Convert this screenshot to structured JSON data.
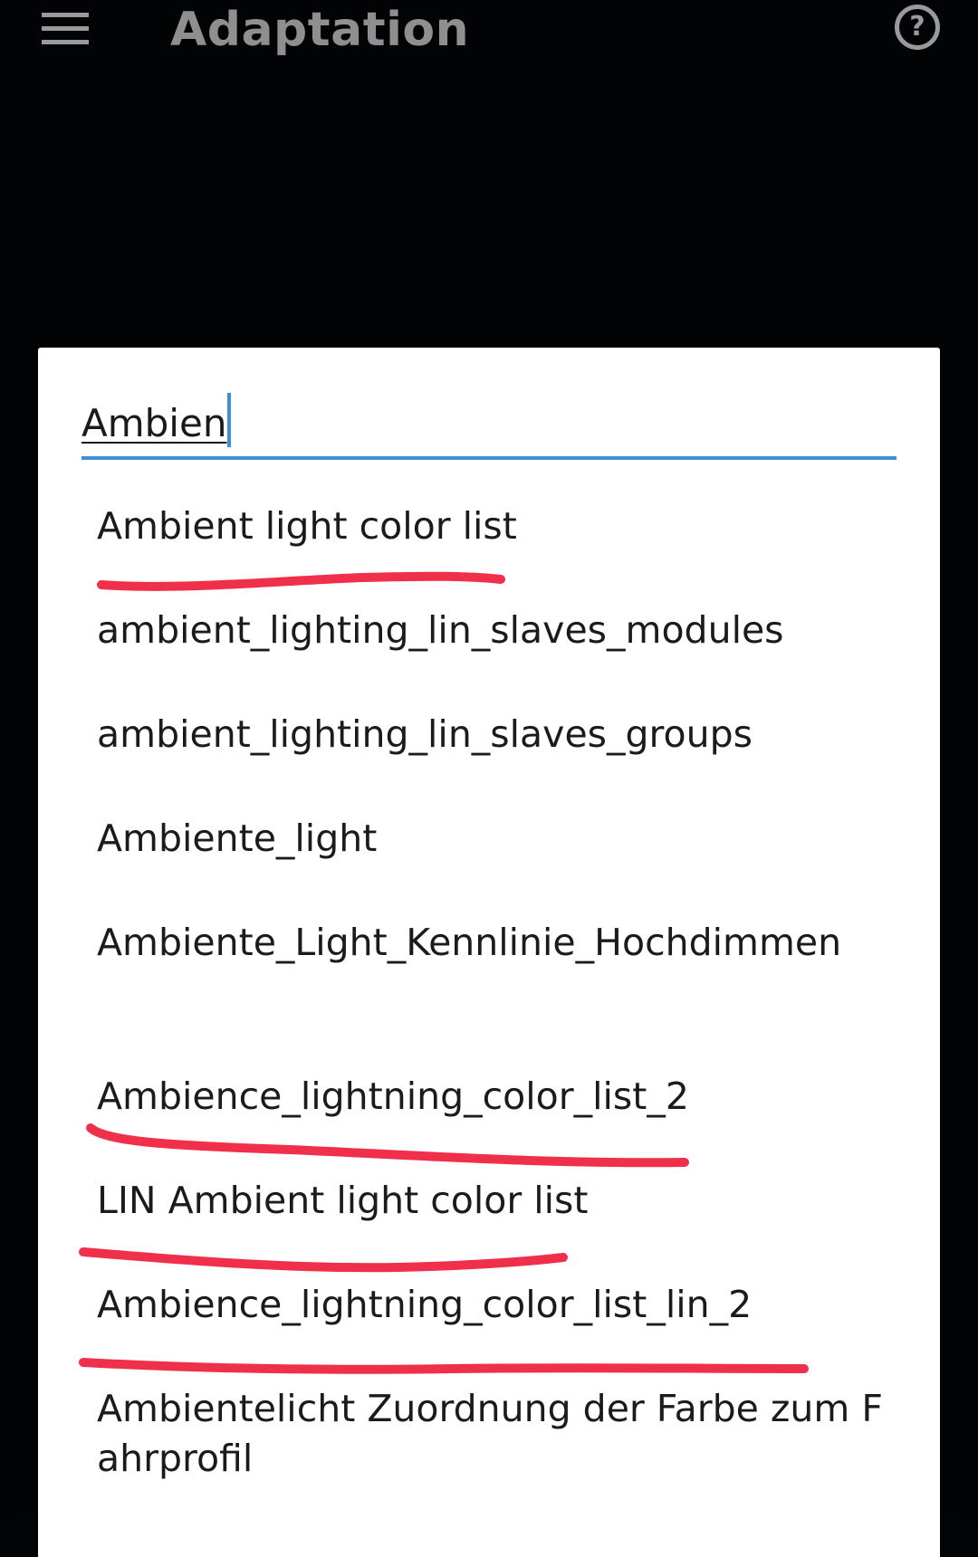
{
  "appbar": {
    "title": "Adaptation",
    "menu_icon": "hamburger-menu-icon",
    "help_icon": "help-circle-icon",
    "help_glyph": "?"
  },
  "search": {
    "value": "Ambien",
    "accent_color": "#3d8fd6"
  },
  "results": [
    {
      "label": "Ambient light color list",
      "underlined": true
    },
    {
      "label": "ambient_lighting_lin_slaves_modules",
      "underlined": false
    },
    {
      "label": "ambient_lighting_lin_slaves_groups",
      "underlined": false
    },
    {
      "label": "Ambiente_light",
      "underlined": false
    },
    {
      "label": "Ambiente_Light_Kennlinie_Hochdimmen",
      "underlined": false
    },
    {
      "label": "Ambience_lightning_color_list_2",
      "underlined": true
    },
    {
      "label": "LIN Ambient light color list",
      "underlined": true
    },
    {
      "label": "Ambience_lightning_color_list_lin_2",
      "underlined": true
    },
    {
      "label": "Ambientelicht Zuordnung der Farbe zum Fahrprofil",
      "underlined": false
    }
  ],
  "annotation_color": "#f0304a"
}
